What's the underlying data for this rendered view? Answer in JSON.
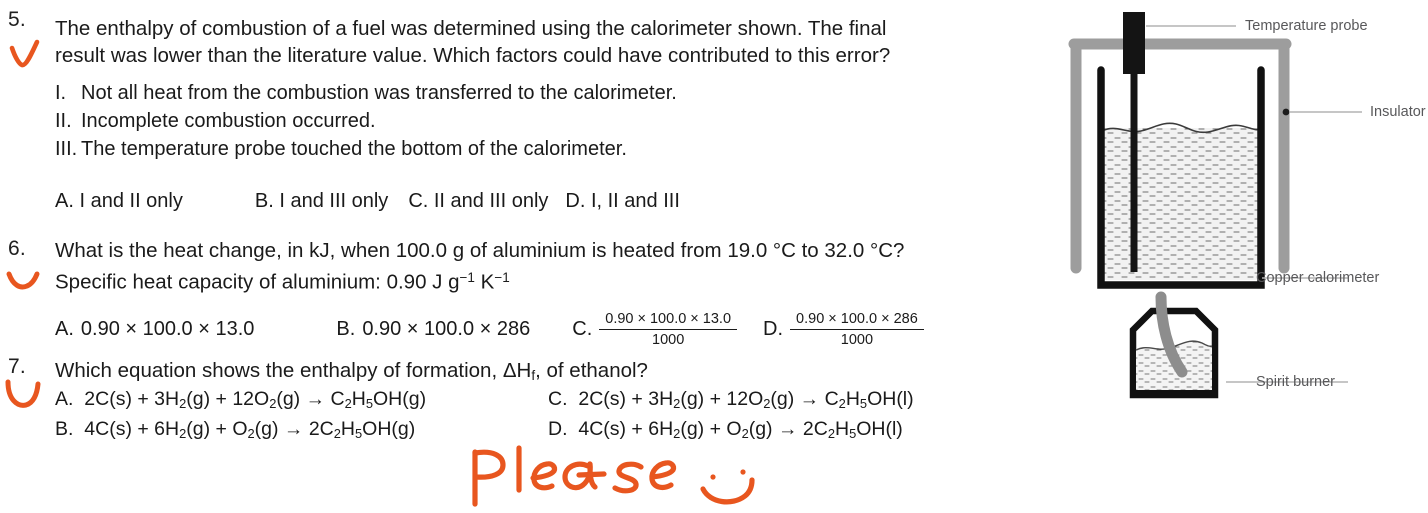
{
  "questions": [
    {
      "number": "5.",
      "stem_lines": [
        "The enthalpy of combustion of a fuel was determined using the calorimeter shown. The final",
        "result was lower than the literature value. Which factors could have contributed to this error?"
      ],
      "statements": [
        {
          "label": "I.",
          "text": "Not all heat from the combustion was transferred to the calorimeter."
        },
        {
          "label": "II.",
          "text": "Incomplete combustion occurred."
        },
        {
          "label": "III.",
          "text": "The temperature probe touched the bottom of the calorimeter."
        }
      ],
      "options": [
        {
          "letter": "A.",
          "text": "I and II only"
        },
        {
          "letter": "B.",
          "text": "I and III only"
        },
        {
          "letter": "C.",
          "text": "II and III only"
        },
        {
          "letter": "D.",
          "text": "I, II and III"
        }
      ],
      "annotation": "orange-check-mark"
    },
    {
      "number": "6.",
      "stem_line_1": "What is the heat change, in kJ, when 100.0 g of aluminium is heated from 19.0 °C to 32.0 °C?",
      "stem_line_2_prefix": "Specific heat capacity of aluminium: 0.90 J g",
      "stem_line_2_sup1": "−1",
      "stem_line_2_mid": " K",
      "stem_line_2_sup2": "−1",
      "options": [
        {
          "letter": "A.",
          "kind": "plain",
          "text": "0.90 × 100.0 × 13.0"
        },
        {
          "letter": "B.",
          "kind": "plain",
          "text": "0.90 × 100.0 × 286"
        },
        {
          "letter": "C.",
          "kind": "fraction",
          "numerator": "0.90 × 100.0 × 13.0",
          "denominator": "1000"
        },
        {
          "letter": "D.",
          "kind": "fraction",
          "numerator": "0.90 × 100.0 × 286",
          "denominator": "1000"
        }
      ],
      "annotation": "orange-curve-mark"
    },
    {
      "number": "7.",
      "stem_prefix": "Which equation shows the enthalpy of formation, ΔH",
      "stem_sub": "f",
      "stem_suffix": ", of ethanol?",
      "equations": [
        {
          "letter": "A.",
          "html_parts": [
            "2C(s) + 3H",
            "2",
            "(g) + 12O",
            "2",
            "(g) → C",
            "2",
            "H",
            "5",
            "OH(g)"
          ]
        },
        {
          "letter": "B.",
          "html_parts": [
            "4C(s) + 6H",
            "2",
            "(g) + O",
            "2",
            "(g) → 2C",
            "2",
            "H",
            "5",
            "OH(g)"
          ]
        },
        {
          "letter": "C.",
          "html_parts": [
            "2C(s) + 3H",
            "2",
            "(g) + 12O",
            "2",
            "(g) → C",
            "2",
            "H",
            "5",
            "OH(l)"
          ]
        },
        {
          "letter": "D.",
          "html_parts": [
            "4C(s) + 6H",
            "2",
            "(g) + O",
            "2",
            "(g) → 2C",
            "2",
            "H",
            "5",
            "OH(l)"
          ]
        }
      ],
      "annotation": "orange-curve-mark"
    }
  ],
  "equations_flat": {
    "a_1": "2C(s) + 3H",
    "a_2": "2",
    "a_3": "(g) + 12O",
    "a_4": "2",
    "a_5": "(g) → C",
    "a_6": "2",
    "a_7": "H",
    "a_8": "5",
    "a_9": "OH(g)",
    "b_1": "4C(s) + 6H",
    "b_2": "2",
    "b_3": "(g) + O",
    "b_4": "2",
    "b_5": "(g) → 2C",
    "b_6": "2",
    "b_7": "H",
    "b_8": "5",
    "b_9": "OH(g)",
    "c_1": "2C(s) + 3H",
    "c_2": "2",
    "c_3": "(g) + 12O",
    "c_4": "2",
    "c_5": "(g) → C",
    "c_6": "2",
    "c_7": "H",
    "c_8": "5",
    "c_9": "OH(l)",
    "d_1": "4C(s) + 6H",
    "d_2": "2",
    "d_3": "(g) + O",
    "d_4": "2",
    "d_5": "(g) → 2C",
    "d_6": "2",
    "d_7": "H",
    "d_8": "5",
    "d_9": "OH(l)",
    "letter_a": "A.",
    "letter_b": "B.",
    "letter_c": "C.",
    "letter_d": "D."
  },
  "handwriting": {
    "text": "Please",
    "emoji": "smiley-face",
    "color": "#e8561f"
  },
  "diagram": {
    "title": "calorimeter-apparatus",
    "labels": {
      "temperature_probe": "Temperature probe",
      "insulator": "Insulator",
      "copper_calorimeter": "Copper calorimeter",
      "spirit_burner": "Spirit burner"
    },
    "colors": {
      "insulator": "#9d9d9d",
      "vessel": "#1a1a1a",
      "probe": "#111111",
      "liquid": "#f0f0f0",
      "label_text": "#58585a",
      "leader_line": "#b5b5b5",
      "wick": "#8a8a8a"
    }
  },
  "annotation_color": "#e8561f"
}
